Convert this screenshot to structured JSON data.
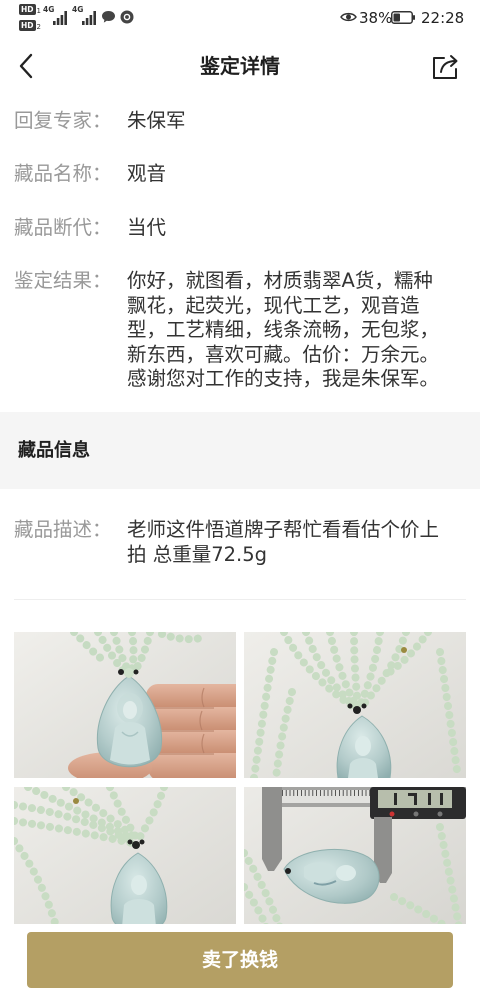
{
  "status_bar": {
    "sim1_badge": "HD",
    "sim1_index": "1",
    "sim2_badge": "HD",
    "sim2_index": "2",
    "network1": "4G",
    "network2": "4G",
    "battery": "38%",
    "time": "22:28",
    "icons": [
      "hd-icon",
      "signal-icon",
      "message-icon",
      "app-notification-icon",
      "eye-icon",
      "battery-icon"
    ]
  },
  "header": {
    "title": "鉴定详情",
    "icons": [
      "chevron-left-icon",
      "share-icon"
    ]
  },
  "appraisal": {
    "rows": [
      {
        "label": "回复专家：",
        "value": "朱保军"
      },
      {
        "label": "藏品名称：",
        "value": "观音"
      },
      {
        "label": "藏品断代：",
        "value": "当代"
      },
      {
        "label": "鉴定结果：",
        "value": "你好，就图看，材质翡翠A货，糯种飘花，起荧光，现代工艺，观音造型，工艺精细，线条流畅，无包浆，新东西，喜欢可藏。估价：万余元。感谢您对工作的支持，我是朱保军。"
      }
    ]
  },
  "item_info": {
    "section_title": "藏品信息",
    "description_label": "藏品描述：",
    "description": "老师这件悟道牌子帮忙看看估个价上拍 总重量72.5g"
  },
  "action": {
    "sell_button": "卖了换钱"
  },
  "colors": {
    "accent": "#b49f64",
    "label": "#999999",
    "text": "#333333",
    "title": "#1f1f1f",
    "section-bg": "#f5f5f5",
    "divider": "#eeeeee"
  }
}
